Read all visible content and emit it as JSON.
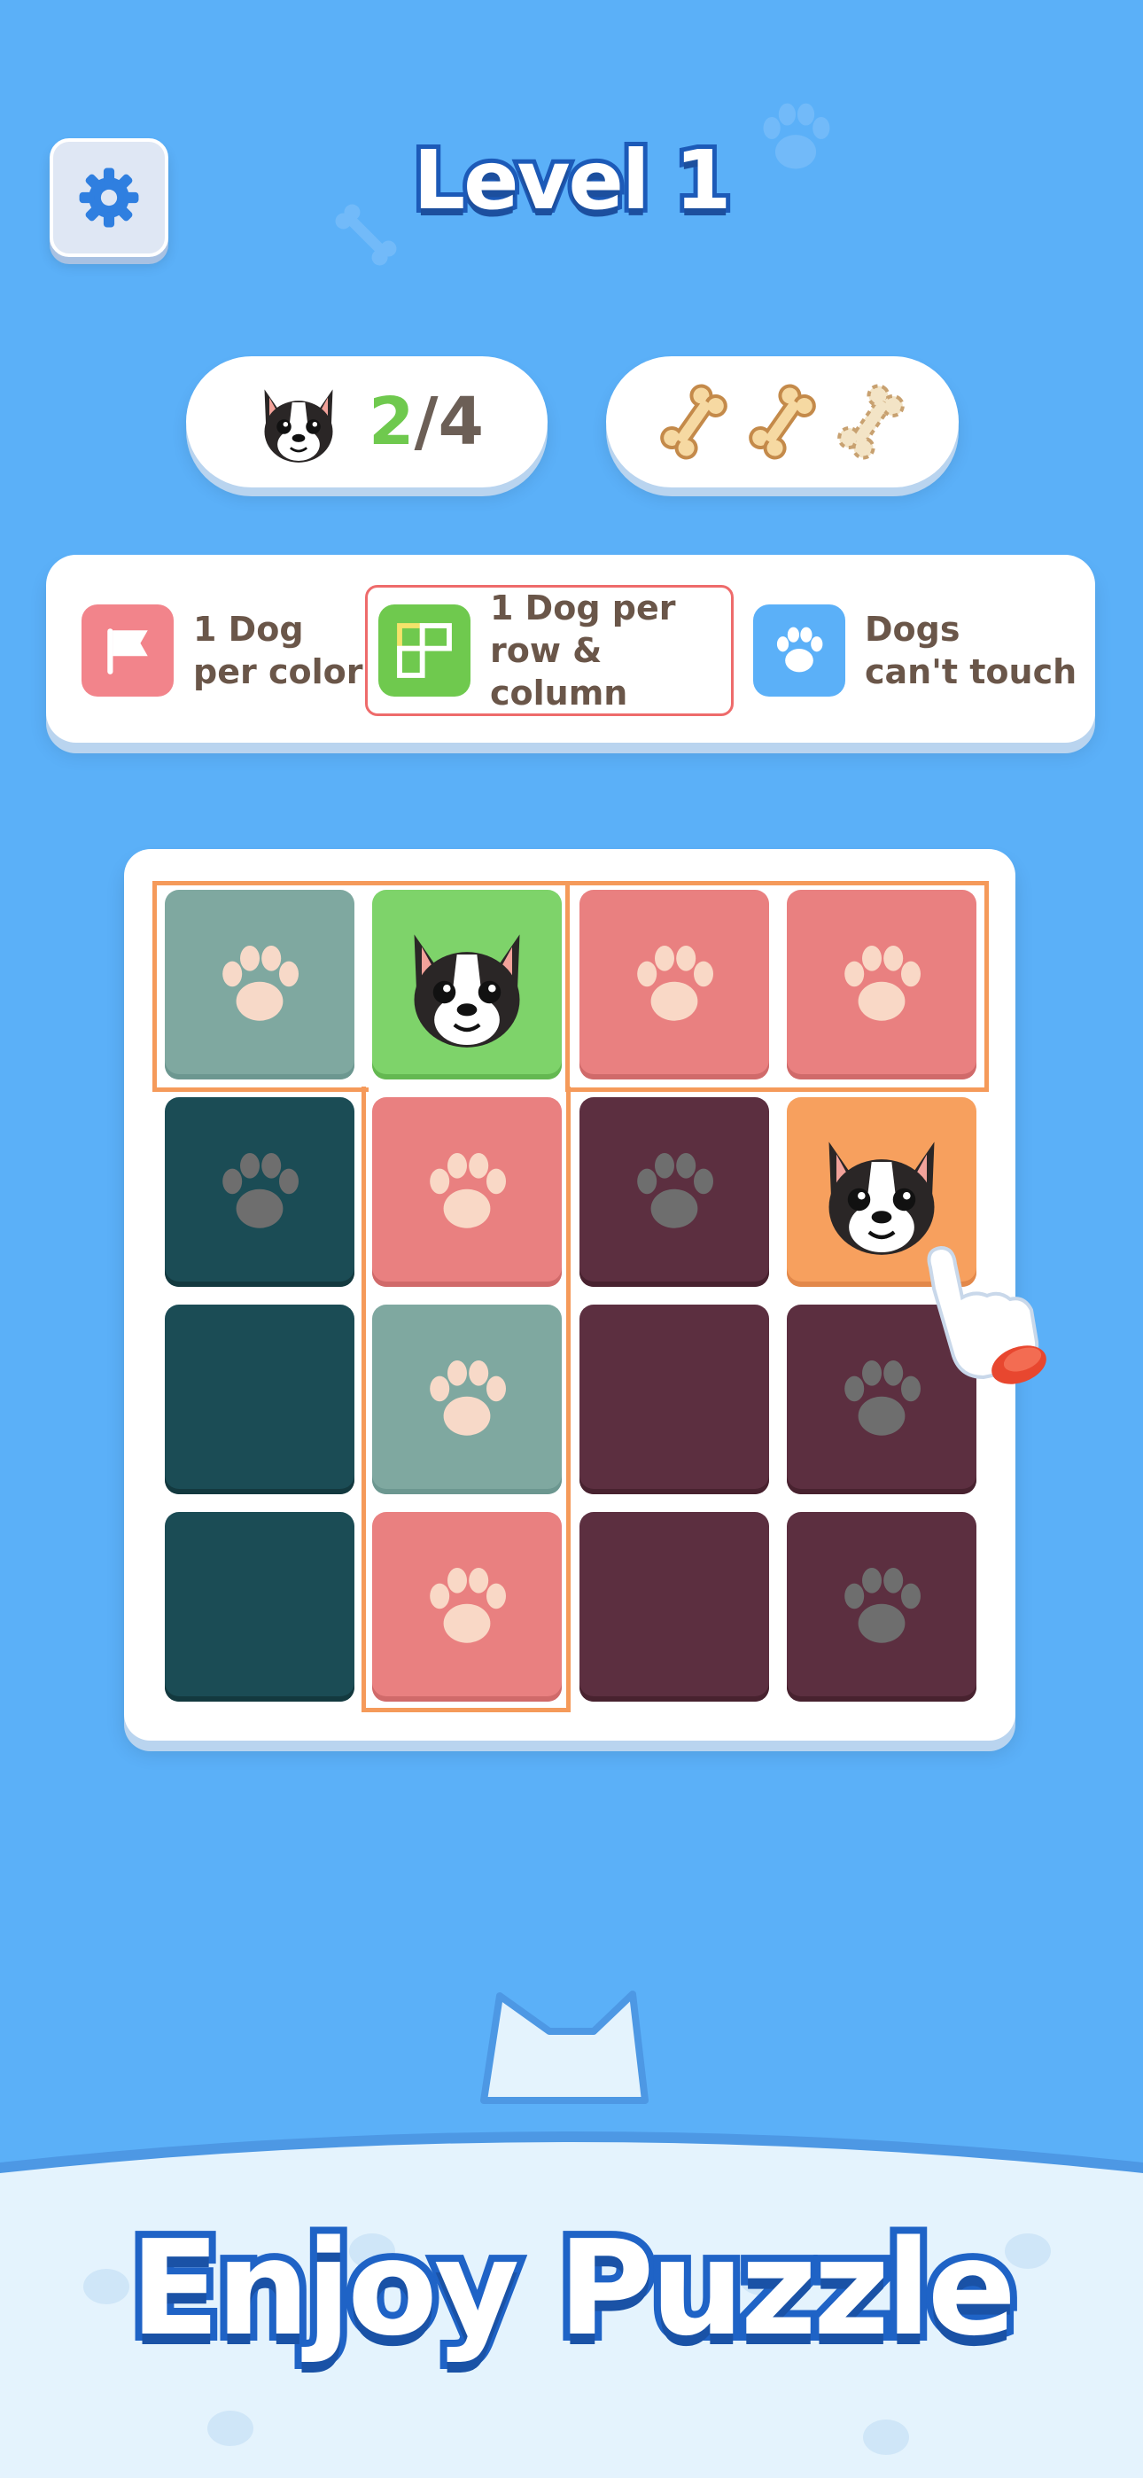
{
  "header": {
    "title": "Level 1",
    "settings_icon": "gear-icon"
  },
  "progress": {
    "dogs_placed": "2",
    "separator": "/",
    "dogs_total": "4",
    "icon": "dog-face-icon"
  },
  "stars": {
    "bones_earned": 2,
    "bones_total": 3,
    "icon": "bone-icon"
  },
  "rules": [
    {
      "label": "1 Dog\nper color",
      "icon": "flag-icon",
      "color": "#f2848b"
    },
    {
      "label": "1 Dog per\nrow & column",
      "icon": "grid-icon",
      "color": "#6fc94e",
      "highlighted": true
    },
    {
      "label": "Dogs\ncan't touch",
      "icon": "paw-icon",
      "color": "#5bb0f8"
    }
  ],
  "board": {
    "size": 4,
    "cells": [
      [
        "paw",
        "dog",
        "paw",
        "paw"
      ],
      [
        "paw",
        "paw",
        "paw",
        "dog"
      ],
      [
        "empty",
        "paw",
        "empty",
        "paw"
      ],
      [
        "empty",
        "paw",
        "empty",
        "paw"
      ]
    ],
    "colors": {
      "sage": "#7fa8a0",
      "green": "#7ed36a",
      "pink": "#e98080",
      "teal": "#1b4c55",
      "plum": "#5c2f40",
      "orange": "#f7a05e"
    }
  },
  "tagline": "Enjoy Puzzle"
}
